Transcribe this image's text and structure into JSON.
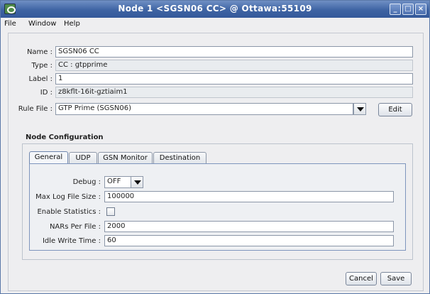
{
  "window": {
    "title": "Node 1 <SGSN06 CC> @ Ottawa:55109",
    "minimize_glyph": "_",
    "maximize_glyph": "□",
    "close_glyph": "×"
  },
  "menu": [
    "File",
    "Window",
    "Help"
  ],
  "form": {
    "name_label": "Name :",
    "name_value": "SGSN06 CC",
    "type_label": "Type :",
    "type_value": "CC : gtpprime",
    "label_label": "Label :",
    "label_value": "1",
    "id_label": "ID :",
    "id_value": "z8kflt-16it-gztiaim1",
    "rule_file_label": "Rule File :",
    "rule_file_value": "GTP Prime (SGSN06)",
    "edit_label": "Edit"
  },
  "node_config": {
    "title": "Node Configuration",
    "tabs": [
      "General",
      "UDP",
      "GSN Monitor",
      "Destination"
    ],
    "active_tab": "General",
    "general": {
      "debug_label": "Debug :",
      "debug_value": "OFF",
      "max_log_label": "Max Log File Size :",
      "max_log_value": "100000",
      "enable_stats_label": "Enable Statistics :",
      "enable_stats_checked": false,
      "nars_label": "NARs Per File :",
      "nars_value": "2000",
      "idle_label": "Idle Write Time :",
      "idle_value": "60"
    }
  },
  "footer": {
    "cancel_label": "Cancel",
    "save_label": "Save"
  },
  "colors": {
    "titlebar": "#3e63a3",
    "background": "#eeeef0"
  }
}
